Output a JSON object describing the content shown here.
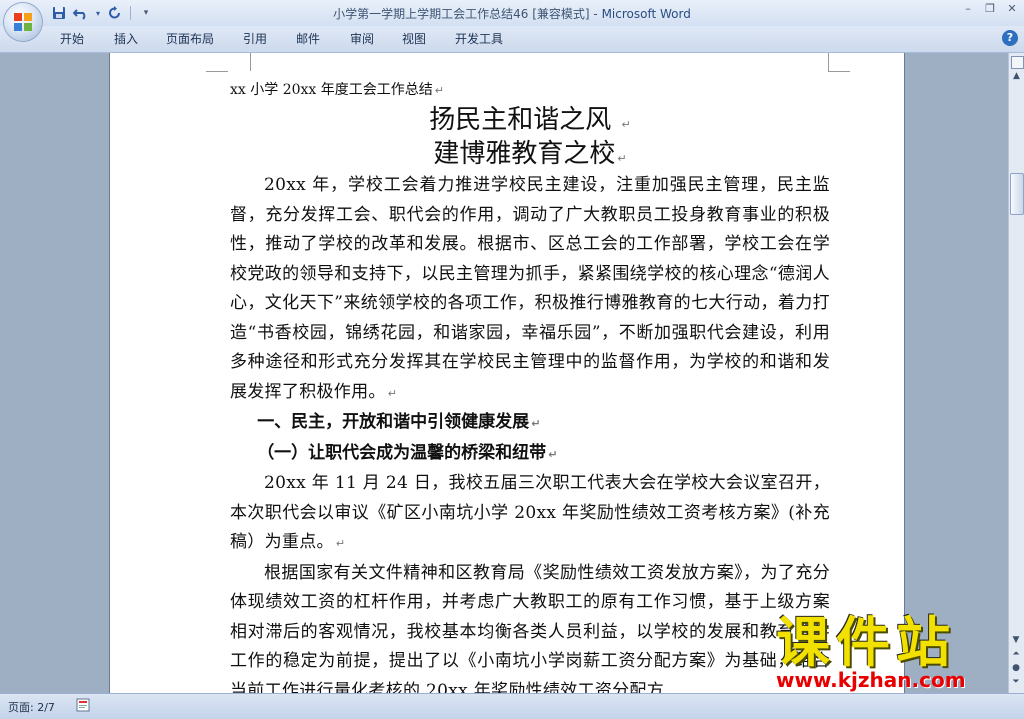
{
  "window": {
    "title": "小学第一学期上学期工会工作总结46 [兼容模式]",
    "title_sep": " - ",
    "app_name": "Microsoft Word",
    "controls": [
      "–",
      "❐",
      "✕"
    ]
  },
  "ribbon": {
    "tabs": [
      "开始",
      "插入",
      "页面布局",
      "引用",
      "邮件",
      "审阅",
      "视图",
      "开发工具"
    ],
    "help": "?"
  },
  "document": {
    "line1": "xx 小学 20xx 年度工会工作总结",
    "title1": "扬民主和谐之风",
    "title2": "建博雅教育之校",
    "para1": "20xx 年，学校工会着力推进学校民主建设，注重加强民主管理，民主监督，充分发挥工会、职代会的作用，调动了广大教职员工投身教育事业的积极性，推动了学校的改革和发展。根据市、区总工会的工作部署，学校工会在学校党政的领导和支持下，以民主管理为抓手，紧紧围绕学校的核心理念“德润人心，文化天下”来统领学校的各项工作，积极推行博雅教育的七大行动，着力打造“书香校园，锦绣花园，和谐家园，幸福乐园”，不断加强职代会建设，利用多种途径和形式充分发挥其在学校民主管理中的监督作用，为学校的和谐和发展发挥了积极作用。",
    "section1": "一、民主，开放和谐中引领健康发展",
    "section1_1": "（一）让职代会成为温馨的桥梁和纽带",
    "para2": "20xx 年 11 月 24 日，我校五届三次职工代表大会在学校大会议室召开，本次职代会以审议《矿区小南坑小学 20xx 年奖励性绩效工资考核方案》(补充稿）为重点。",
    "para3": "根据国家有关文件精神和区教育局《奖励性绩效工资发放方案》，为了充分体现绩效工资的杠杆作用，并考虑广大教职工的原有工作习惯，基于上级方案相对滞后的客观情况，我校基本均衡各类人员利益，以学校的发展和教育教学工作的稳定为前提，提出了以《小南坑小学岗薪工资分配方案》为基础，结合当前工作进行量化考核的 20xx 年奖励性绩效工资分配方",
    "para_mark": "↵"
  },
  "status": {
    "page": "页面: 2/7"
  },
  "watermark": {
    "text": "课件站",
    "url": "www.kjzhan.com"
  },
  "colors": {
    "title_bar": "#d3e0f2",
    "workspace": "#9eaec3",
    "watermark_text": "#f2e100",
    "watermark_url": "#e80000"
  }
}
